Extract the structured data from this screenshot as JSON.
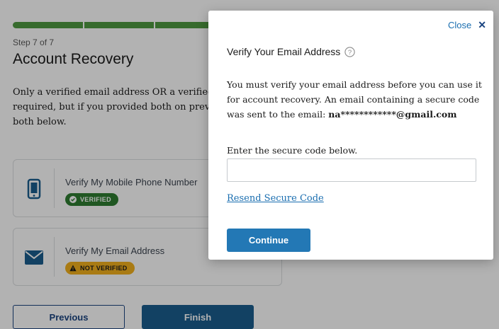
{
  "progress": {
    "steps_total": 7,
    "steps_complete": 7,
    "color": "#4f9a41"
  },
  "page": {
    "step_label": "Step 7 of 7",
    "title": "Account Recovery",
    "intro_lines": [
      "Only a verified email address OR a verified m",
      "required, but if you provided both on previo",
      "both below."
    ]
  },
  "cards": {
    "phone": {
      "icon": "mobile-phone-icon",
      "title": "Verify My Mobile Phone Number",
      "status": "VERIFIED",
      "status_color": "#2e7d32"
    },
    "email": {
      "icon": "envelope-icon",
      "title": "Verify My Email Address",
      "status": "NOT VERIFIED",
      "status_color": "#f2b01e"
    }
  },
  "footer": {
    "previous_label": "Previous",
    "finish_label": "Finish"
  },
  "modal": {
    "close_label": "Close",
    "title": "Verify Your Email Address",
    "body_text": "You must verify your email address before you can use it for account recovery. An email containing a secure code was sent to the email: ",
    "masked_email": "na************@gmail.com",
    "code_label": "Enter the secure code below.",
    "code_value": "",
    "resend_label": "Resend Secure Code",
    "continue_label": "Continue"
  },
  "colors": {
    "primary": "#1a4480",
    "link": "#1a6eb0",
    "continue": "#2378b5"
  }
}
